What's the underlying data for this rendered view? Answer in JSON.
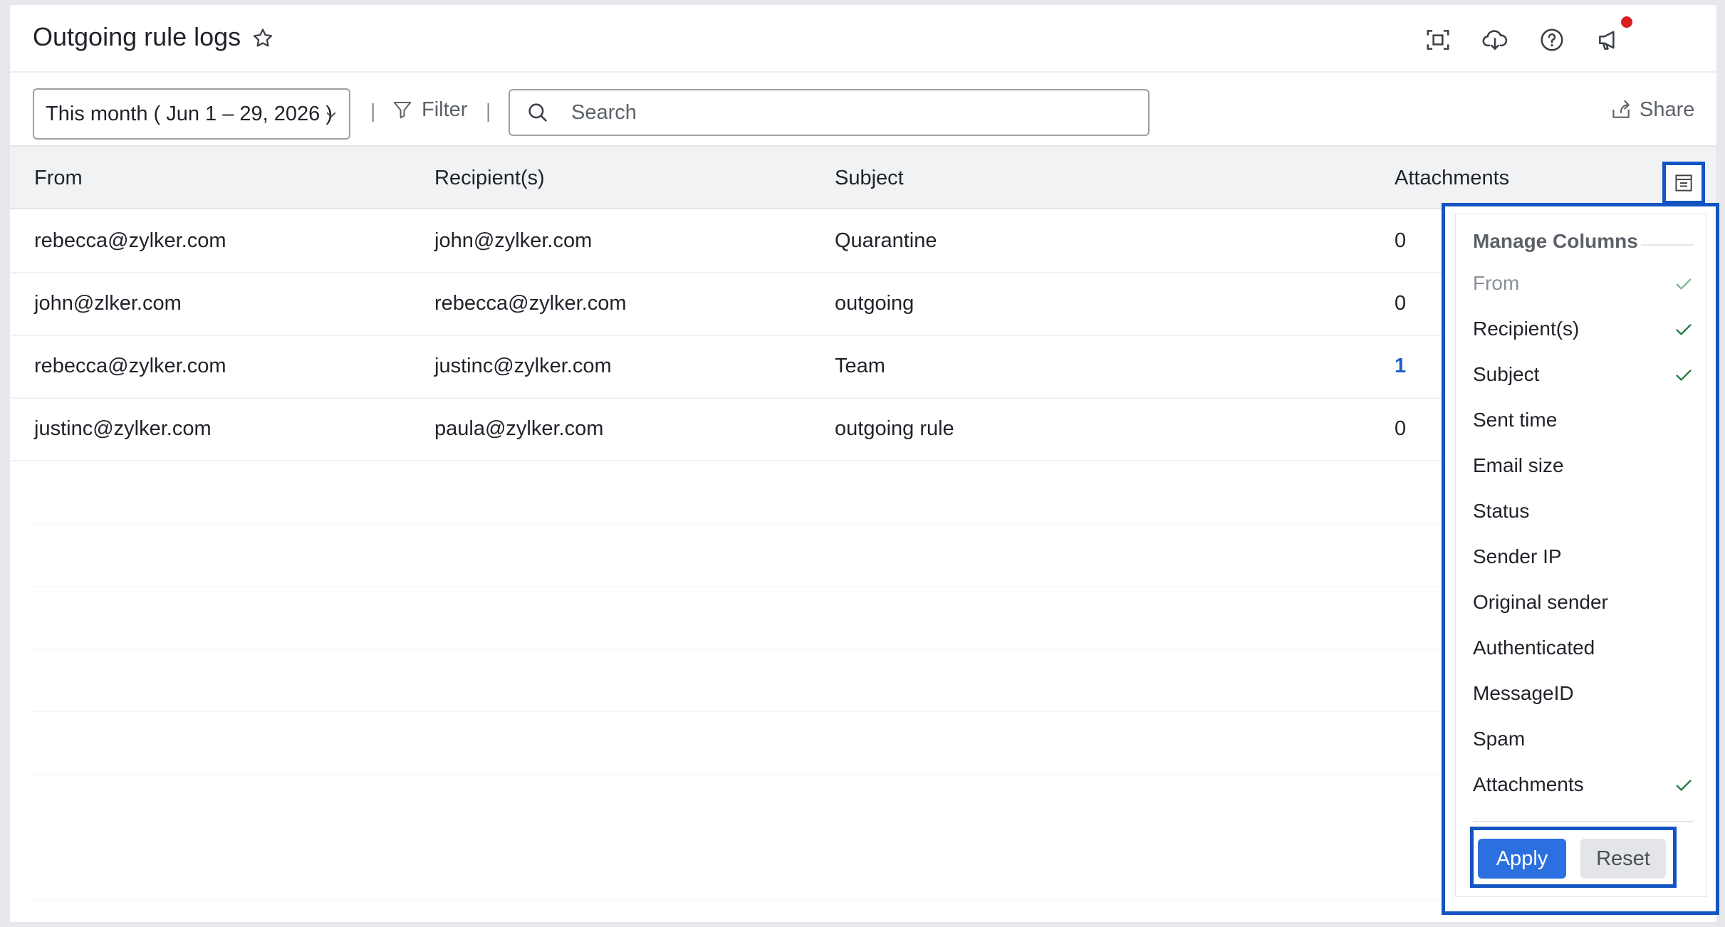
{
  "header": {
    "title": "Outgoing rule logs",
    "icons": [
      "star-icon",
      "screenshot-icon",
      "cloud-download-icon",
      "help-icon",
      "announcement-icon"
    ]
  },
  "toolbar": {
    "date_range": "This month ( Jun 1 – 29, 2026 )",
    "filter_label": "Filter",
    "search_placeholder": "Search",
    "share_label": "Share"
  },
  "table": {
    "columns": [
      "From",
      "Recipient(s)",
      "Subject",
      "Attachments"
    ],
    "rows": [
      {
        "from": "rebecca@zylker.com",
        "recipients": "john@zylker.com",
        "subject": "Quarantine",
        "attachments": "0"
      },
      {
        "from": "john@zlker.com",
        "recipients": "rebecca@zylker.com",
        "subject": "outgoing",
        "attachments": "0"
      },
      {
        "from": "rebecca@zylker.com",
        "recipients": "justinc@zylker.com",
        "subject": "Team",
        "attachments": "1"
      },
      {
        "from": "justinc@zylker.com",
        "recipients": "paula@zylker.com",
        "subject": "outgoing rule",
        "attachments": "0"
      }
    ]
  },
  "manage_columns": {
    "title": "Manage Columns",
    "options": [
      {
        "label": "From",
        "checked": true,
        "disabled": true
      },
      {
        "label": "Recipient(s)",
        "checked": true,
        "disabled": false
      },
      {
        "label": "Subject",
        "checked": true,
        "disabled": false
      },
      {
        "label": "Sent time",
        "checked": false,
        "disabled": false
      },
      {
        "label": "Email size",
        "checked": false,
        "disabled": false
      },
      {
        "label": "Status",
        "checked": false,
        "disabled": false
      },
      {
        "label": "Sender IP",
        "checked": false,
        "disabled": false
      },
      {
        "label": "Original sender",
        "checked": false,
        "disabled": false
      },
      {
        "label": "Authenticated",
        "checked": false,
        "disabled": false
      },
      {
        "label": "MessageID",
        "checked": false,
        "disabled": false
      },
      {
        "label": "Spam",
        "checked": false,
        "disabled": false
      },
      {
        "label": "Attachments",
        "checked": true,
        "disabled": false
      }
    ],
    "apply_label": "Apply",
    "reset_label": "Reset"
  },
  "colors": {
    "accent": "#2c6fe0",
    "highlight": "#1454c2",
    "check": "#1e7a3c",
    "notification": "#d7201f"
  }
}
